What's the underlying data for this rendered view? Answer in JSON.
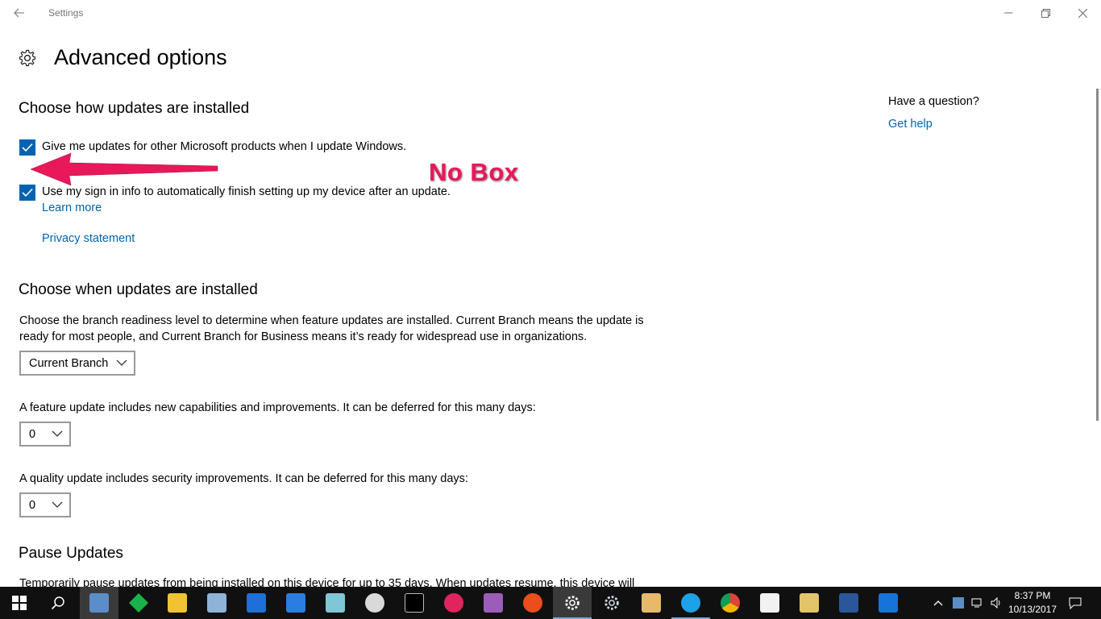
{
  "window": {
    "title": "Settings"
  },
  "page": {
    "title": "Advanced options"
  },
  "install_section": {
    "heading": "Choose how updates are installed",
    "checkbox1": {
      "label": "Give me updates for other Microsoft products when I update Windows.",
      "checked": true
    },
    "checkbox2": {
      "label": "Use my sign in info to automatically finish setting up my device after an update.",
      "checked": true
    },
    "learn_more": "Learn more",
    "privacy": "Privacy statement"
  },
  "when_section": {
    "heading": "Choose when updates are installed",
    "description": "Choose the branch readiness level to determine when feature updates are installed. Current Branch means the update is ready for most people, and Current Branch for Business means it’s ready for widespread use in organizations.",
    "branch_selected": "Current Branch",
    "feature_text": "A feature update includes new capabilities and improvements. It can be deferred for this many days:",
    "feature_days": "0",
    "quality_text": "A quality update includes security improvements. It can be deferred for this many days:",
    "quality_days": "0"
  },
  "pause_section": {
    "heading": "Pause Updates",
    "description": "Temporarily pause updates from being installed on this device for up to 35 days. When updates resume, this device will"
  },
  "help": {
    "question": "Have a question?",
    "link": "Get help"
  },
  "annotation": {
    "text": "No Box",
    "color": "#e8185a"
  },
  "accent_color": "#0063b1",
  "taskbar": {
    "clock_time": "8:37 PM",
    "clock_date": "10/13/2017",
    "apps": [
      {
        "name": "start-icon"
      },
      {
        "name": "search-icon"
      },
      {
        "name": "control-panel-icon"
      },
      {
        "name": "stack-icon"
      },
      {
        "name": "file-explorer-icon"
      },
      {
        "name": "network-drive-icon"
      },
      {
        "name": "shield-icon"
      },
      {
        "name": "defender-icon"
      },
      {
        "name": "notepad-icon"
      },
      {
        "name": "paint-icon"
      },
      {
        "name": "command-prompt-icon"
      },
      {
        "name": "lips-icon"
      },
      {
        "name": "archive-icon"
      },
      {
        "name": "ccleaner-icon"
      },
      {
        "name": "settings-icon"
      },
      {
        "name": "gear-icon"
      },
      {
        "name": "tools-icon"
      },
      {
        "name": "internet-explorer-icon"
      },
      {
        "name": "chrome-icon"
      },
      {
        "name": "mail-icon"
      },
      {
        "name": "folder-icon"
      },
      {
        "name": "word-icon"
      },
      {
        "name": "malwarebytes-icon"
      }
    ]
  }
}
